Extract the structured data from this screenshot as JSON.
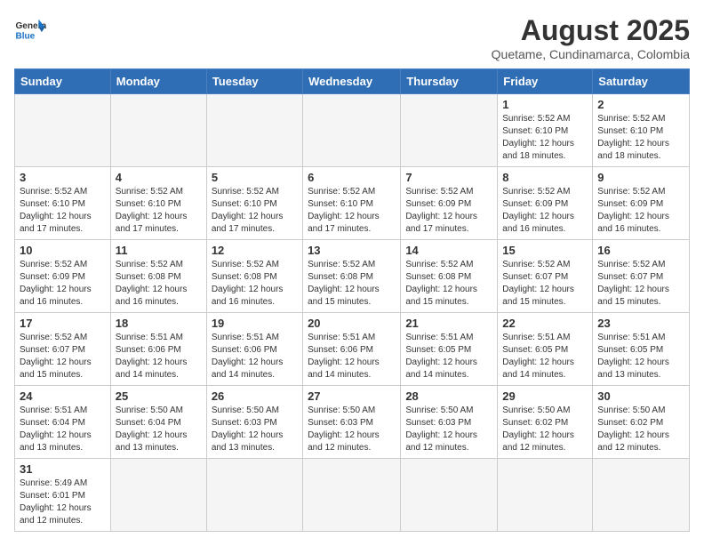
{
  "header": {
    "logo_general": "General",
    "logo_blue": "Blue",
    "title": "August 2025",
    "subtitle": "Quetame, Cundinamarca, Colombia"
  },
  "days_of_week": [
    "Sunday",
    "Monday",
    "Tuesday",
    "Wednesday",
    "Thursday",
    "Friday",
    "Saturday"
  ],
  "weeks": [
    [
      {
        "day": "",
        "info": ""
      },
      {
        "day": "",
        "info": ""
      },
      {
        "day": "",
        "info": ""
      },
      {
        "day": "",
        "info": ""
      },
      {
        "day": "",
        "info": ""
      },
      {
        "day": "1",
        "info": "Sunrise: 5:52 AM\nSunset: 6:10 PM\nDaylight: 12 hours\nand 18 minutes."
      },
      {
        "day": "2",
        "info": "Sunrise: 5:52 AM\nSunset: 6:10 PM\nDaylight: 12 hours\nand 18 minutes."
      }
    ],
    [
      {
        "day": "3",
        "info": "Sunrise: 5:52 AM\nSunset: 6:10 PM\nDaylight: 12 hours\nand 17 minutes."
      },
      {
        "day": "4",
        "info": "Sunrise: 5:52 AM\nSunset: 6:10 PM\nDaylight: 12 hours\nand 17 minutes."
      },
      {
        "day": "5",
        "info": "Sunrise: 5:52 AM\nSunset: 6:10 PM\nDaylight: 12 hours\nand 17 minutes."
      },
      {
        "day": "6",
        "info": "Sunrise: 5:52 AM\nSunset: 6:10 PM\nDaylight: 12 hours\nand 17 minutes."
      },
      {
        "day": "7",
        "info": "Sunrise: 5:52 AM\nSunset: 6:09 PM\nDaylight: 12 hours\nand 17 minutes."
      },
      {
        "day": "8",
        "info": "Sunrise: 5:52 AM\nSunset: 6:09 PM\nDaylight: 12 hours\nand 16 minutes."
      },
      {
        "day": "9",
        "info": "Sunrise: 5:52 AM\nSunset: 6:09 PM\nDaylight: 12 hours\nand 16 minutes."
      }
    ],
    [
      {
        "day": "10",
        "info": "Sunrise: 5:52 AM\nSunset: 6:09 PM\nDaylight: 12 hours\nand 16 minutes."
      },
      {
        "day": "11",
        "info": "Sunrise: 5:52 AM\nSunset: 6:08 PM\nDaylight: 12 hours\nand 16 minutes."
      },
      {
        "day": "12",
        "info": "Sunrise: 5:52 AM\nSunset: 6:08 PM\nDaylight: 12 hours\nand 16 minutes."
      },
      {
        "day": "13",
        "info": "Sunrise: 5:52 AM\nSunset: 6:08 PM\nDaylight: 12 hours\nand 15 minutes."
      },
      {
        "day": "14",
        "info": "Sunrise: 5:52 AM\nSunset: 6:08 PM\nDaylight: 12 hours\nand 15 minutes."
      },
      {
        "day": "15",
        "info": "Sunrise: 5:52 AM\nSunset: 6:07 PM\nDaylight: 12 hours\nand 15 minutes."
      },
      {
        "day": "16",
        "info": "Sunrise: 5:52 AM\nSunset: 6:07 PM\nDaylight: 12 hours\nand 15 minutes."
      }
    ],
    [
      {
        "day": "17",
        "info": "Sunrise: 5:52 AM\nSunset: 6:07 PM\nDaylight: 12 hours\nand 15 minutes."
      },
      {
        "day": "18",
        "info": "Sunrise: 5:51 AM\nSunset: 6:06 PM\nDaylight: 12 hours\nand 14 minutes."
      },
      {
        "day": "19",
        "info": "Sunrise: 5:51 AM\nSunset: 6:06 PM\nDaylight: 12 hours\nand 14 minutes."
      },
      {
        "day": "20",
        "info": "Sunrise: 5:51 AM\nSunset: 6:06 PM\nDaylight: 12 hours\nand 14 minutes."
      },
      {
        "day": "21",
        "info": "Sunrise: 5:51 AM\nSunset: 6:05 PM\nDaylight: 12 hours\nand 14 minutes."
      },
      {
        "day": "22",
        "info": "Sunrise: 5:51 AM\nSunset: 6:05 PM\nDaylight: 12 hours\nand 14 minutes."
      },
      {
        "day": "23",
        "info": "Sunrise: 5:51 AM\nSunset: 6:05 PM\nDaylight: 12 hours\nand 13 minutes."
      }
    ],
    [
      {
        "day": "24",
        "info": "Sunrise: 5:51 AM\nSunset: 6:04 PM\nDaylight: 12 hours\nand 13 minutes."
      },
      {
        "day": "25",
        "info": "Sunrise: 5:50 AM\nSunset: 6:04 PM\nDaylight: 12 hours\nand 13 minutes."
      },
      {
        "day": "26",
        "info": "Sunrise: 5:50 AM\nSunset: 6:03 PM\nDaylight: 12 hours\nand 13 minutes."
      },
      {
        "day": "27",
        "info": "Sunrise: 5:50 AM\nSunset: 6:03 PM\nDaylight: 12 hours\nand 12 minutes."
      },
      {
        "day": "28",
        "info": "Sunrise: 5:50 AM\nSunset: 6:03 PM\nDaylight: 12 hours\nand 12 minutes."
      },
      {
        "day": "29",
        "info": "Sunrise: 5:50 AM\nSunset: 6:02 PM\nDaylight: 12 hours\nand 12 minutes."
      },
      {
        "day": "30",
        "info": "Sunrise: 5:50 AM\nSunset: 6:02 PM\nDaylight: 12 hours\nand 12 minutes."
      }
    ],
    [
      {
        "day": "31",
        "info": "Sunrise: 5:49 AM\nSunset: 6:01 PM\nDaylight: 12 hours\nand 12 minutes."
      },
      {
        "day": "",
        "info": ""
      },
      {
        "day": "",
        "info": ""
      },
      {
        "day": "",
        "info": ""
      },
      {
        "day": "",
        "info": ""
      },
      {
        "day": "",
        "info": ""
      },
      {
        "day": "",
        "info": ""
      }
    ]
  ]
}
